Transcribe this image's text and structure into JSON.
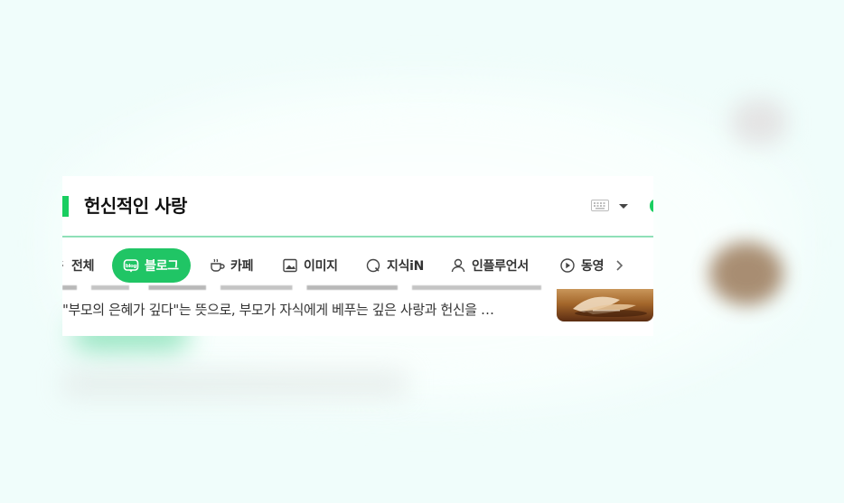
{
  "search": {
    "query": "헌신적인 사랑"
  },
  "tabs": [
    {
      "label": "전체",
      "icon": "all-icon",
      "active": false
    },
    {
      "label": "블로그",
      "icon": "blog-icon",
      "active": true
    },
    {
      "label": "카페",
      "icon": "cafe-icon",
      "active": false
    },
    {
      "label": "이미지",
      "icon": "image-icon",
      "active": false
    },
    {
      "label": "지식iN",
      "icon": "kin-icon",
      "active": false
    },
    {
      "label": "인플루언서",
      "icon": "influencer-icon",
      "active": false
    },
    {
      "label": "동영",
      "icon": "video-icon",
      "active": false
    }
  ],
  "result": {
    "snippet": "\"부모의 은혜가 깊다\"는 뜻으로, 부모가 자식에게 베푸는 깊은 사랑과 헌신을 …"
  },
  "colors": {
    "accent": "#20c565",
    "background": "#f0fdfb"
  }
}
